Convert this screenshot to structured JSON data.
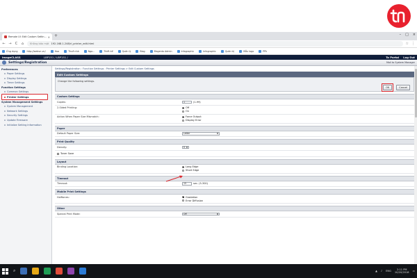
{
  "browser": {
    "tab_title": "Remote UI: Edit Custom Settin...",
    "tab_close": "×",
    "new_tab": "+",
    "window_controls": [
      "–",
      "□",
      "×"
    ],
    "nav": {
      "back": "←",
      "forward": "→",
      "reload": "C",
      "home": "⌂"
    },
    "address": {
      "warning": "Không bảo mật",
      "url": "192.168.1.248/rl_printer_edit.html"
    },
    "bookmarks": [
      "Ứng dụng",
      "http://webvn.vn/",
      "Hoa",
      "Thuê nhà",
      "Ngo...",
      "Thiết kế",
      "Quản lý",
      "Blog",
      "Magento Admin",
      "Infographic",
      "Infographic",
      "Quản trị",
      "Mẫu logo",
      "PPk"
    ]
  },
  "app": {
    "model": "imageCLASS",
    "location": "LBP151 / LBP151 /",
    "portal": "To Portal",
    "logout": "Log Out",
    "section_title": "Settings/Registration",
    "mail_link": "Mail to System Manager"
  },
  "sidebar": {
    "groups": [
      {
        "head": "Preferences",
        "items": [
          "Paper Settings",
          "Display Settings",
          "Timer Settings"
        ]
      },
      {
        "head": "Function Settings",
        "items": [
          "Common Settings",
          "Printer Settings"
        ]
      },
      {
        "head": "System Management Settings",
        "items": [
          "System Management",
          "Network Settings",
          "Security Settings",
          "Update Firmware",
          "Initialize Setting Information"
        ]
      }
    ],
    "active": "Printer Settings"
  },
  "main": {
    "breadcrumb": "Settings/Registration : Function Settings : Printer Settings > Edit Custom Settings",
    "page_head": "Edit Custom Settings",
    "note": "Change the following settings.",
    "ok": "OK",
    "cancel": "Cancel",
    "sections": {
      "custom": {
        "head": "Custom Settings",
        "copies_label": "Copies:",
        "copies_value": "1",
        "copies_range": "(1-99)",
        "two_sided_label": "2-Sided Printing:",
        "two_sided_opts": [
          "Off",
          "On"
        ],
        "mismatch_label": "Action When Paper Size Mismatch:",
        "mismatch_opts": [
          "Force Output",
          "Display Error"
        ]
      },
      "paper": {
        "head": "Paper",
        "label": "Default Paper Size:",
        "value": "Letter"
      },
      "quality": {
        "head": "Print Quality",
        "density_label": "Density:",
        "density_value": "0",
        "toner_save": "Toner Save"
      },
      "layout": {
        "head": "Layout",
        "label": "Binding Location:",
        "opts": [
          "Long Edge",
          "Short Edge"
        ]
      },
      "timeout": {
        "head": "Timeout",
        "label": "Timeout:",
        "value": "15",
        "unit": "sec. (5-300)"
      },
      "mobile": {
        "head": "Mobile Print Settings",
        "label": "Halftones:",
        "opts": [
          "Gradation",
          "Error Diffusion"
        ]
      },
      "other": {
        "head": "Other",
        "label": "Special Print Mode:",
        "value": "Off"
      }
    }
  },
  "taskbar": {
    "search": "⌕",
    "lang": "ENG",
    "time": "2:11 PM",
    "date": "10/20/2018"
  },
  "colors": {
    "accent_red": "#d9262c",
    "header_navy": "#0f1d3a",
    "logo_red": "#e8212e"
  }
}
